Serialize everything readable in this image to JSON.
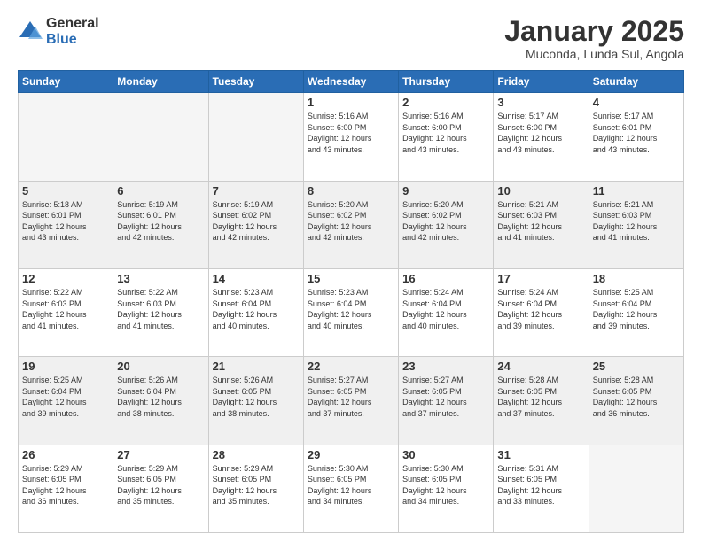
{
  "logo": {
    "general": "General",
    "blue": "Blue"
  },
  "header": {
    "title": "January 2025",
    "subtitle": "Muconda, Lunda Sul, Angola"
  },
  "days_of_week": [
    "Sunday",
    "Monday",
    "Tuesday",
    "Wednesday",
    "Thursday",
    "Friday",
    "Saturday"
  ],
  "weeks": [
    {
      "shaded": false,
      "days": [
        {
          "num": "",
          "info": ""
        },
        {
          "num": "",
          "info": ""
        },
        {
          "num": "",
          "info": ""
        },
        {
          "num": "1",
          "info": "Sunrise: 5:16 AM\nSunset: 6:00 PM\nDaylight: 12 hours\nand 43 minutes."
        },
        {
          "num": "2",
          "info": "Sunrise: 5:16 AM\nSunset: 6:00 PM\nDaylight: 12 hours\nand 43 minutes."
        },
        {
          "num": "3",
          "info": "Sunrise: 5:17 AM\nSunset: 6:00 PM\nDaylight: 12 hours\nand 43 minutes."
        },
        {
          "num": "4",
          "info": "Sunrise: 5:17 AM\nSunset: 6:01 PM\nDaylight: 12 hours\nand 43 minutes."
        }
      ]
    },
    {
      "shaded": true,
      "days": [
        {
          "num": "5",
          "info": "Sunrise: 5:18 AM\nSunset: 6:01 PM\nDaylight: 12 hours\nand 43 minutes."
        },
        {
          "num": "6",
          "info": "Sunrise: 5:19 AM\nSunset: 6:01 PM\nDaylight: 12 hours\nand 42 minutes."
        },
        {
          "num": "7",
          "info": "Sunrise: 5:19 AM\nSunset: 6:02 PM\nDaylight: 12 hours\nand 42 minutes."
        },
        {
          "num": "8",
          "info": "Sunrise: 5:20 AM\nSunset: 6:02 PM\nDaylight: 12 hours\nand 42 minutes."
        },
        {
          "num": "9",
          "info": "Sunrise: 5:20 AM\nSunset: 6:02 PM\nDaylight: 12 hours\nand 42 minutes."
        },
        {
          "num": "10",
          "info": "Sunrise: 5:21 AM\nSunset: 6:03 PM\nDaylight: 12 hours\nand 41 minutes."
        },
        {
          "num": "11",
          "info": "Sunrise: 5:21 AM\nSunset: 6:03 PM\nDaylight: 12 hours\nand 41 minutes."
        }
      ]
    },
    {
      "shaded": false,
      "days": [
        {
          "num": "12",
          "info": "Sunrise: 5:22 AM\nSunset: 6:03 PM\nDaylight: 12 hours\nand 41 minutes."
        },
        {
          "num": "13",
          "info": "Sunrise: 5:22 AM\nSunset: 6:03 PM\nDaylight: 12 hours\nand 41 minutes."
        },
        {
          "num": "14",
          "info": "Sunrise: 5:23 AM\nSunset: 6:04 PM\nDaylight: 12 hours\nand 40 minutes."
        },
        {
          "num": "15",
          "info": "Sunrise: 5:23 AM\nSunset: 6:04 PM\nDaylight: 12 hours\nand 40 minutes."
        },
        {
          "num": "16",
          "info": "Sunrise: 5:24 AM\nSunset: 6:04 PM\nDaylight: 12 hours\nand 40 minutes."
        },
        {
          "num": "17",
          "info": "Sunrise: 5:24 AM\nSunset: 6:04 PM\nDaylight: 12 hours\nand 39 minutes."
        },
        {
          "num": "18",
          "info": "Sunrise: 5:25 AM\nSunset: 6:04 PM\nDaylight: 12 hours\nand 39 minutes."
        }
      ]
    },
    {
      "shaded": true,
      "days": [
        {
          "num": "19",
          "info": "Sunrise: 5:25 AM\nSunset: 6:04 PM\nDaylight: 12 hours\nand 39 minutes."
        },
        {
          "num": "20",
          "info": "Sunrise: 5:26 AM\nSunset: 6:04 PM\nDaylight: 12 hours\nand 38 minutes."
        },
        {
          "num": "21",
          "info": "Sunrise: 5:26 AM\nSunset: 6:05 PM\nDaylight: 12 hours\nand 38 minutes."
        },
        {
          "num": "22",
          "info": "Sunrise: 5:27 AM\nSunset: 6:05 PM\nDaylight: 12 hours\nand 37 minutes."
        },
        {
          "num": "23",
          "info": "Sunrise: 5:27 AM\nSunset: 6:05 PM\nDaylight: 12 hours\nand 37 minutes."
        },
        {
          "num": "24",
          "info": "Sunrise: 5:28 AM\nSunset: 6:05 PM\nDaylight: 12 hours\nand 37 minutes."
        },
        {
          "num": "25",
          "info": "Sunrise: 5:28 AM\nSunset: 6:05 PM\nDaylight: 12 hours\nand 36 minutes."
        }
      ]
    },
    {
      "shaded": false,
      "days": [
        {
          "num": "26",
          "info": "Sunrise: 5:29 AM\nSunset: 6:05 PM\nDaylight: 12 hours\nand 36 minutes."
        },
        {
          "num": "27",
          "info": "Sunrise: 5:29 AM\nSunset: 6:05 PM\nDaylight: 12 hours\nand 35 minutes."
        },
        {
          "num": "28",
          "info": "Sunrise: 5:29 AM\nSunset: 6:05 PM\nDaylight: 12 hours\nand 35 minutes."
        },
        {
          "num": "29",
          "info": "Sunrise: 5:30 AM\nSunset: 6:05 PM\nDaylight: 12 hours\nand 34 minutes."
        },
        {
          "num": "30",
          "info": "Sunrise: 5:30 AM\nSunset: 6:05 PM\nDaylight: 12 hours\nand 34 minutes."
        },
        {
          "num": "31",
          "info": "Sunrise: 5:31 AM\nSunset: 6:05 PM\nDaylight: 12 hours\nand 33 minutes."
        },
        {
          "num": "",
          "info": ""
        }
      ]
    }
  ]
}
